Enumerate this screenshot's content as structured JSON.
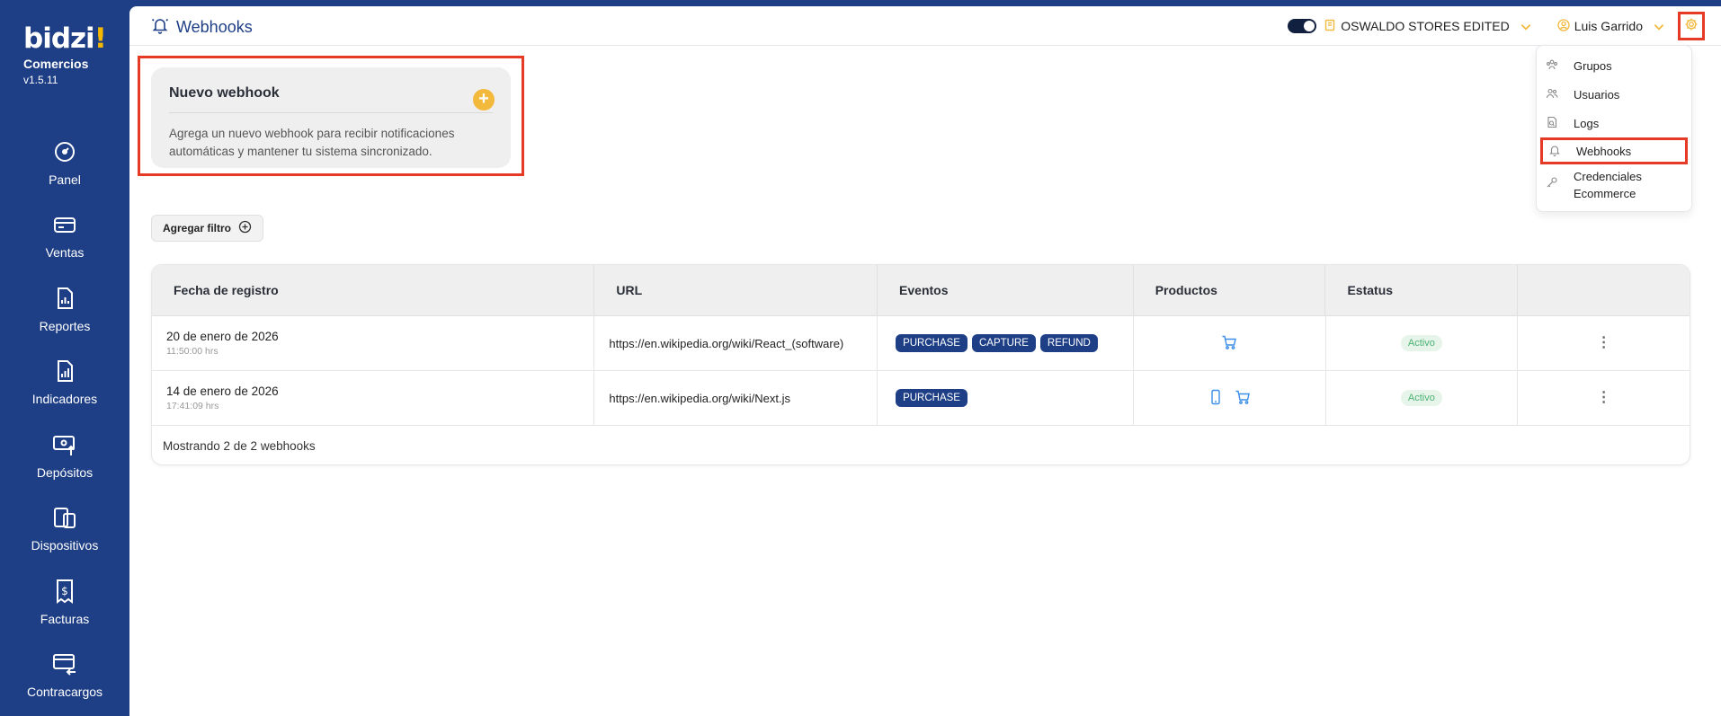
{
  "brand": {
    "logo": "bidzi",
    "logo_dot": "!",
    "subtitle": "Comercios",
    "version": "v1.5.11"
  },
  "sidebar": {
    "items": [
      {
        "label": "Panel",
        "icon": "gauge-icon"
      },
      {
        "label": "Ventas",
        "icon": "card-icon"
      },
      {
        "label": "Reportes",
        "icon": "report-icon"
      },
      {
        "label": "Indicadores",
        "icon": "chart-doc-icon"
      },
      {
        "label": "Depósitos",
        "icon": "deposit-icon"
      },
      {
        "label": "Dispositivos",
        "icon": "devices-icon"
      },
      {
        "label": "Facturas",
        "icon": "invoice-icon"
      },
      {
        "label": "Contracargos",
        "icon": "chargeback-icon"
      }
    ]
  },
  "header": {
    "title": "Webhooks",
    "store_name": "OSWALDO STORES EDITED",
    "user_name": "Luis Garrido"
  },
  "settings_menu": {
    "items": [
      {
        "label": "Grupos",
        "icon": "groups-icon"
      },
      {
        "label": "Usuarios",
        "icon": "users-icon"
      },
      {
        "label": "Logs",
        "icon": "logs-icon"
      },
      {
        "label": "Webhooks",
        "icon": "bell-icon"
      },
      {
        "label": "Credenciales Ecommerce",
        "icon": "key-icon"
      }
    ]
  },
  "new_webhook": {
    "title": "Nuevo webhook",
    "description": "Agrega un nuevo webhook para recibir notificaciones automáticas y mantener tu sistema sincronizado.",
    "add_symbol": "+"
  },
  "filter": {
    "label": "Agregar filtro"
  },
  "table": {
    "columns": [
      "Fecha de registro",
      "URL",
      "Eventos",
      "Productos",
      "Estatus",
      ""
    ],
    "rows": [
      {
        "date": "20 de enero de 2026",
        "time": "11:50:00 hrs",
        "url": "https://en.wikipedia.org/wiki/React_(software)",
        "events": [
          "PURCHASE",
          "CAPTURE",
          "REFUND"
        ],
        "status": "Activo"
      },
      {
        "date": "14 de enero de 2026",
        "time": "17:41:09 hrs",
        "url": "https://en.wikipedia.org/wiki/Next.js",
        "events": [
          "PURCHASE"
        ],
        "status": "Activo"
      }
    ],
    "footer": "Mostrando 2 de 2 webhooks"
  },
  "colors": {
    "sidebar": "#1e3f86",
    "accent": "#f3b93d",
    "highlight": "#e53a25",
    "badge": "#1e3f86",
    "status_text": "#4bb273"
  }
}
